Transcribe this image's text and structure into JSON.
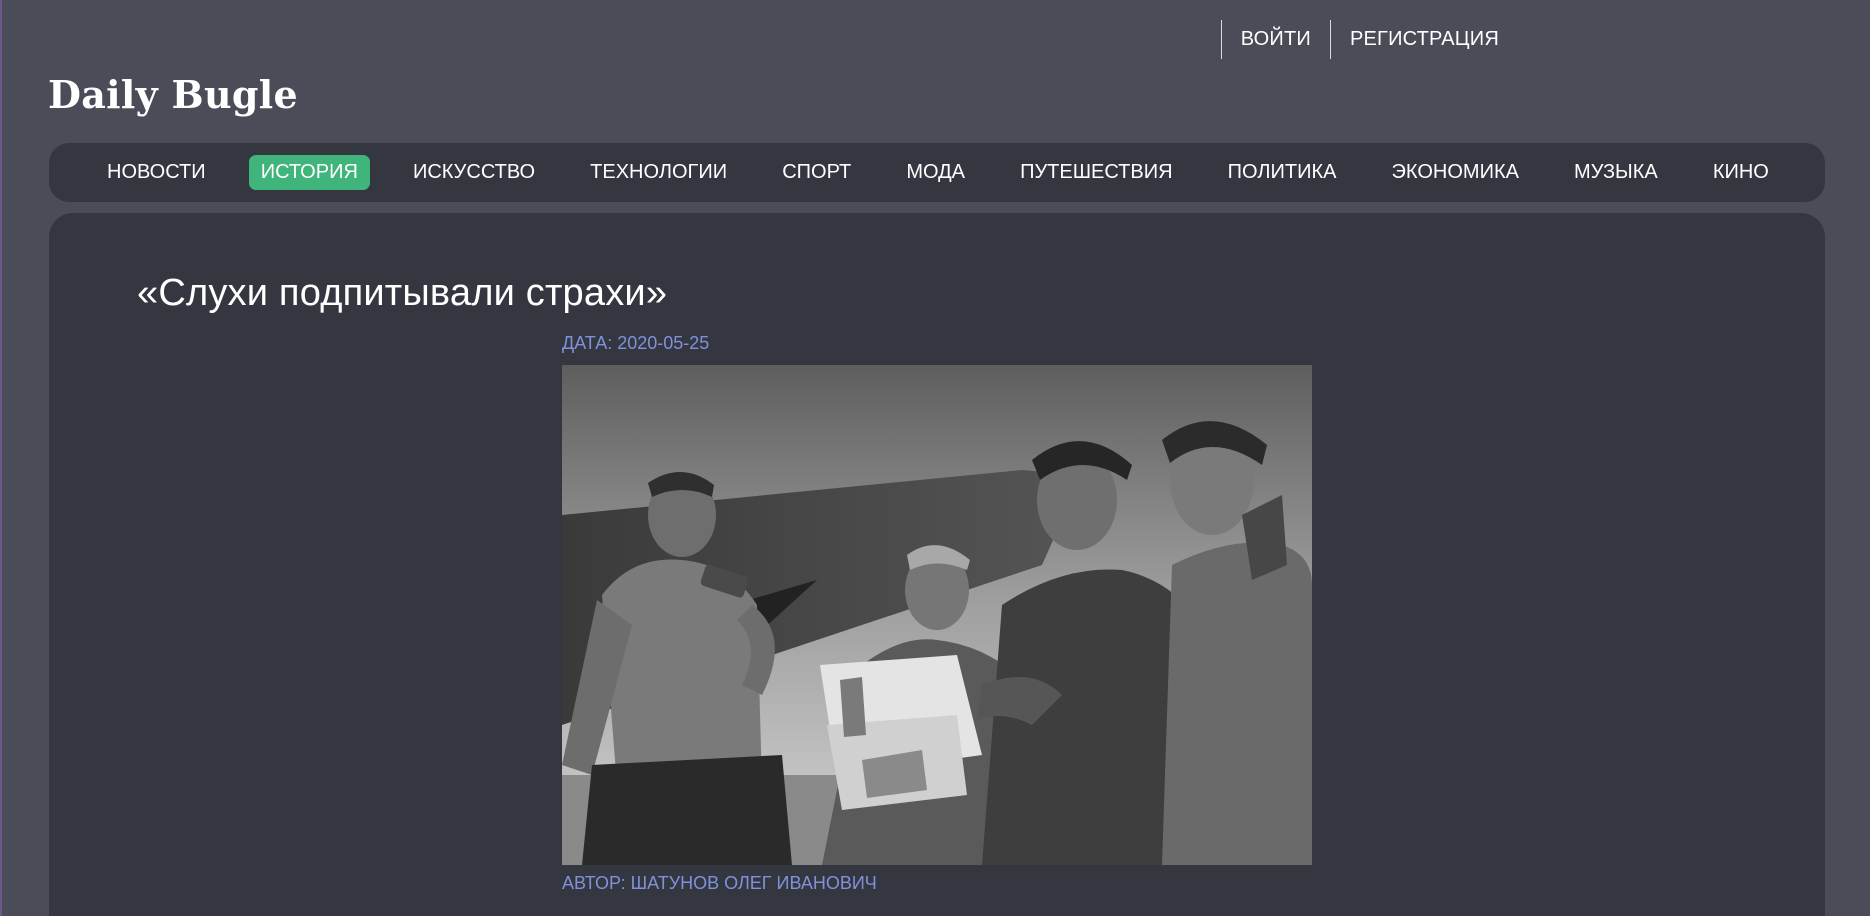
{
  "site": {
    "logo": "Daily Bugle"
  },
  "auth": {
    "login_label": "ВОЙТИ",
    "register_label": "РЕГИСТРАЦИЯ"
  },
  "nav": {
    "active": "ИСТОРИЯ",
    "items": [
      {
        "label": "НОВОСТИ"
      },
      {
        "label": "ИСТОРИЯ"
      },
      {
        "label": "ИСКУССТВО"
      },
      {
        "label": "ТЕХНОЛОГИИ"
      },
      {
        "label": "СПОРТ"
      },
      {
        "label": "МОДА"
      },
      {
        "label": "ПУТЕШЕСТВИЯ"
      },
      {
        "label": "ПОЛИТИКА"
      },
      {
        "label": "ЭКОНОМИКА"
      },
      {
        "label": "МУЗЫКА"
      },
      {
        "label": "КИНО"
      }
    ]
  },
  "article": {
    "title": "«Слухи подпитывали страхи»",
    "date_label": "ДАТА: 2020-05-25",
    "author_label": "АВТОР: ШАТУНОВ ОЛЕГ ИВАНОВИЧ",
    "photo_icon": "article-photo"
  },
  "colors": {
    "page_bg": "#4a4d57",
    "panel_bg": "#353740",
    "accent": "#3fb47b",
    "meta_text": "#7f92d9"
  }
}
